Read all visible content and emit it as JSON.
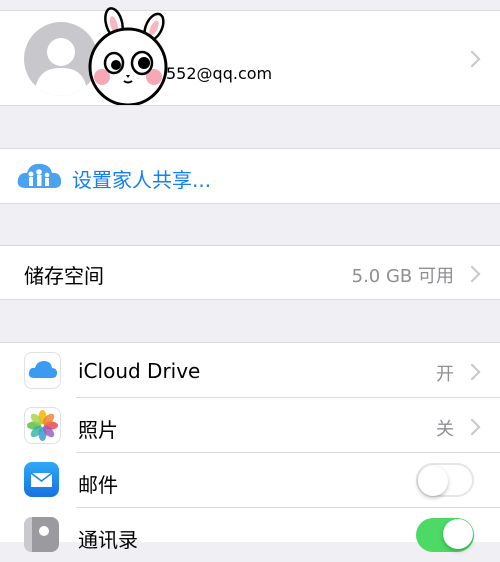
{
  "profile": {
    "email_fragment": "552@qq.com"
  },
  "family": {
    "label": "设置家人共享..."
  },
  "storage": {
    "label": "储存空间",
    "value": "5.0 GB 可用"
  },
  "apps": [
    {
      "label": "iCloud Drive",
      "value": "开",
      "icon": "icloud-drive-icon"
    },
    {
      "label": "照片",
      "value": "关",
      "icon": "photos-icon"
    },
    {
      "label": "邮件",
      "toggle": false,
      "icon": "mail-icon"
    },
    {
      "label": "通讯录",
      "toggle": true,
      "icon": "contacts-icon"
    }
  ],
  "colors": {
    "link": "#147efb",
    "toggle_on": "#4cd964",
    "background": "#efeff4"
  }
}
